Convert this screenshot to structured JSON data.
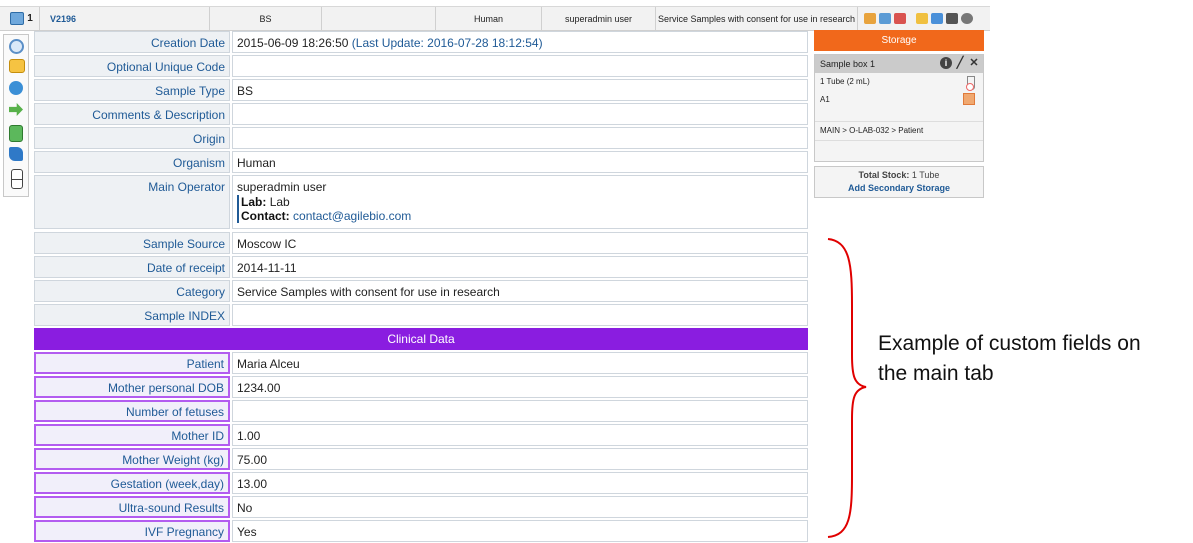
{
  "header": {
    "count": "1",
    "code": "V2196",
    "sample_type": "BS",
    "organism": "Human",
    "operator": "superadmin user",
    "category": "Service Samples with consent for use in research"
  },
  "sidebar_tools": [
    "search-icon",
    "edit-icon",
    "gear-icon",
    "export-arrow-icon",
    "flask-icon",
    "book-icon",
    "fridge-icon"
  ],
  "form": {
    "creation_date_label": "Creation Date",
    "creation_date": "2015-06-09 18:26:50",
    "last_update": "(Last Update: 2016-07-28 18:12:54)",
    "optional_code_label": "Optional Unique Code",
    "optional_code": "",
    "sample_type_label": "Sample Type",
    "sample_type": "BS",
    "comments_label": "Comments & Description",
    "comments": "",
    "origin_label": "Origin",
    "origin": "",
    "organism_label": "Organism",
    "organism": "Human",
    "main_operator_label": "Main Operator",
    "main_operator": "superadmin user",
    "lab_label": "Lab:",
    "lab": "Lab",
    "contact_label": "Contact:",
    "contact": "contact@agilebio.com",
    "sample_source_label": "Sample Source",
    "sample_source": "Moscow IC",
    "date_receipt_label": "Date of receipt",
    "date_receipt": "2014-11-11",
    "category_label": "Category",
    "category": "Service Samples with consent for use in research",
    "sample_index_label": "Sample INDEX",
    "sample_index": ""
  },
  "clinical": {
    "title": "Clinical Data",
    "fields": [
      {
        "label": "Patient",
        "value": "Maria Alceu"
      },
      {
        "label": "Mother personal DOB",
        "value": "1234.00"
      },
      {
        "label": "Number of fetuses",
        "value": ""
      },
      {
        "label": "Mother ID",
        "value": "1.00"
      },
      {
        "label": "Mother Weight (kg)",
        "value": "75.00"
      },
      {
        "label": "Gestation (week,day)",
        "value": "13.00"
      },
      {
        "label": "Ultra-sound Results",
        "value": "No"
      },
      {
        "label": "IVF Pregnancy",
        "value": "Yes"
      }
    ]
  },
  "storage": {
    "title": "Storage",
    "box_name": "Sample box 1",
    "tube": "1 Tube (2 mL)",
    "position": "A1",
    "path": "MAIN > O-LAB-032 > Patient",
    "total_stock_label": "Total Stock:",
    "total_stock": "1 Tube",
    "add_secondary": "Add Secondary Storage"
  },
  "annotation": {
    "line1": "Example of custom fields on",
    "line2": "the main tab"
  },
  "colors": {
    "storage_header": "#f1681b",
    "clinical_header": "#8a1de0",
    "clinical_border": "#b35cf0",
    "link": "#1f5a96",
    "brace": "#e00000"
  }
}
